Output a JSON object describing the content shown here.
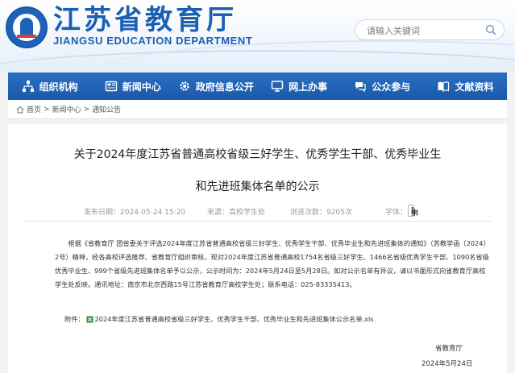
{
  "header": {
    "title": "江苏省教育厅",
    "subtitle": "JIANGSU EDUCATION DEPARTMENT",
    "search_placeholder": "请输入关键词"
  },
  "nav": {
    "items": [
      {
        "label": "组织机构",
        "icon": "org-chart-icon"
      },
      {
        "label": "新闻中心",
        "icon": "news-icon"
      },
      {
        "label": "政府信息公开",
        "icon": "gear-icon"
      },
      {
        "label": "网上办事",
        "icon": "monitor-icon"
      },
      {
        "label": "公众参与",
        "icon": "chat-icon"
      },
      {
        "label": "文献资料",
        "icon": "book-icon"
      }
    ]
  },
  "breadcrumb": {
    "items": [
      "首页",
      "新闻中心",
      "通知公告"
    ],
    "separator": ">"
  },
  "article": {
    "title_line1": "关于2024年度江苏省普通高校省级三好学生、优秀学生干部、优秀毕业生",
    "title_line2": "和先进班集体名单的公示",
    "published_label": "发布日期：",
    "published_value": "2024-05-24 15:20",
    "source_label": "来源：",
    "source_value": "高校学生处",
    "views_label": "浏览次数：",
    "views_value": "9205次",
    "fontsize_label": "字体：",
    "fontsize_open": "[",
    "fontsize_large": "大",
    "fontsize_medium": "中",
    "fontsize_small": "小",
    "fontsize_close": "]",
    "body": "根据《省教育厅 团省委关于评选2024年度江苏省普通高校省级三好学生、优秀学生干部、优秀毕业生和先进班集体的通知》（苏教学函〔2024〕2号）精神，经各高校评选推荐、省教育厅组织审核，现对2024年度江苏省普通高校1754名省级三好学生、1466名省级优秀学生干部、1090名省级优秀毕业生、999个省级先进班集体名单予以公示，公示时间为：2024年5月24日至5月28日。如对公示名单有异议，请以书面形式向省教育厅高校学生处反映。通讯地址：南京市北京西路15号江苏省教育厅高校学生处；联系电话：025-83335413。",
    "attachment_label": "附件：",
    "attachment_name": "2024年度江苏省普通高校省级三好学生、优秀学生干部、优秀毕业生和先进班集体公示名单.xls",
    "signature": "省教育厅",
    "date": "2024年5月24日"
  },
  "colors": {
    "brand_blue": "#1b5fb4",
    "nav_blue": "#1a59a9",
    "attachment_green": "#2e8b3a"
  }
}
